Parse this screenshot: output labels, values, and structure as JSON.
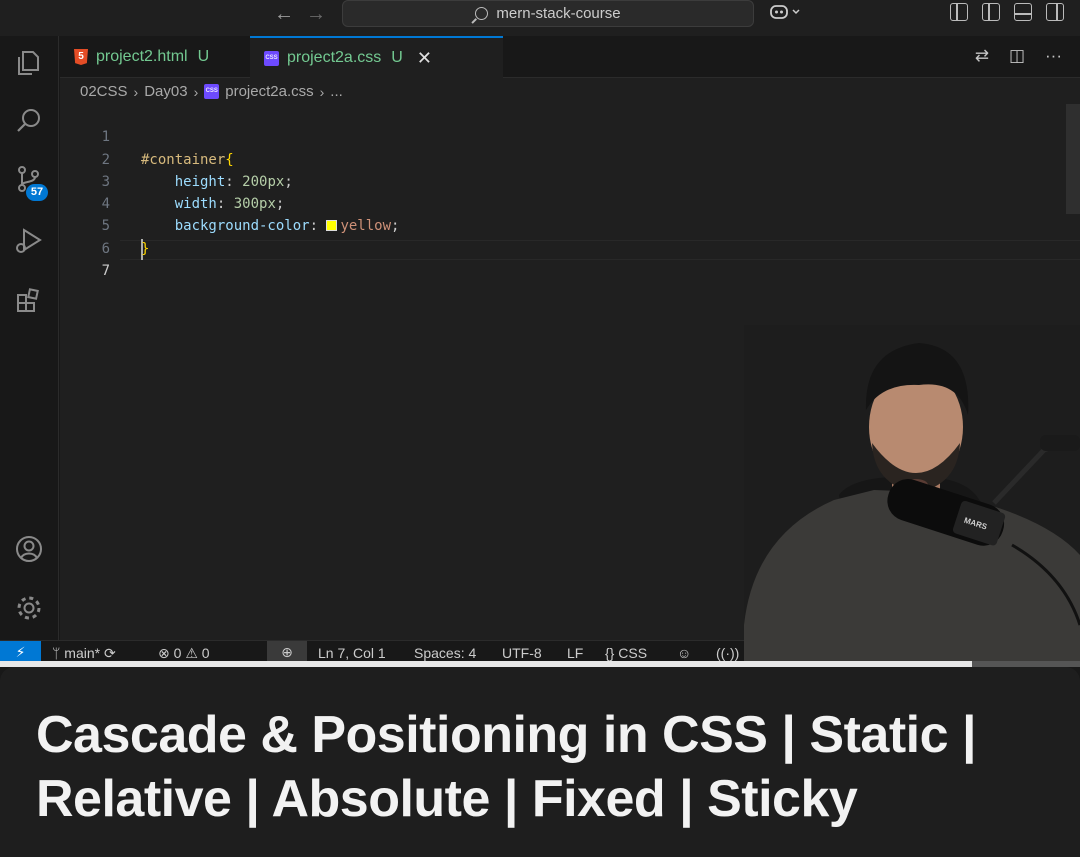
{
  "titlebar": {
    "back_icon": "arrow-left-icon",
    "forward_icon": "arrow-right-icon",
    "search_text": "mern-stack-course",
    "copilot_icon": "copilot-icon"
  },
  "activity_bar": {
    "items": [
      "explorer-icon",
      "search-icon",
      "source-control-icon",
      "run-debug-icon",
      "extensions-icon",
      "account-icon",
      "settings-gear-icon"
    ],
    "source_control_badge": "57"
  },
  "tabs": [
    {
      "label": "project2.html",
      "status": "U",
      "active": false
    },
    {
      "label": "project2a.css",
      "status": "U",
      "active": true
    }
  ],
  "breadcrumb": {
    "parts": [
      "02CSS",
      "Day03",
      "project2a.css",
      "..."
    ]
  },
  "editor": {
    "line_numbers": [
      "1",
      "2",
      "3",
      "4",
      "5",
      "6",
      "7"
    ],
    "code": {
      "l1_selector": "#container",
      "l1_brace": "{",
      "l2_prop": "height",
      "l2_val": "200px",
      "l3_prop": "width",
      "l3_val": "300px",
      "l4_prop": "background-color",
      "l4_val": "yellow",
      "l5_brace": "}"
    },
    "swatch_color": "#ffff00"
  },
  "statusbar": {
    "branch": "main*",
    "errors": "0",
    "warnings": "0",
    "position": "Ln 7, Col 1",
    "spaces": "Spaces: 4",
    "encoding": "UTF-8",
    "eol": "LF",
    "language": "CSS"
  },
  "video": {
    "progress": 0.9,
    "caption": "Cascade & Positioning in CSS | Static | Relative | Absolute | Fixed | Sticky"
  },
  "colors": {
    "accent": "#0078d4",
    "modified": "#73c991"
  }
}
